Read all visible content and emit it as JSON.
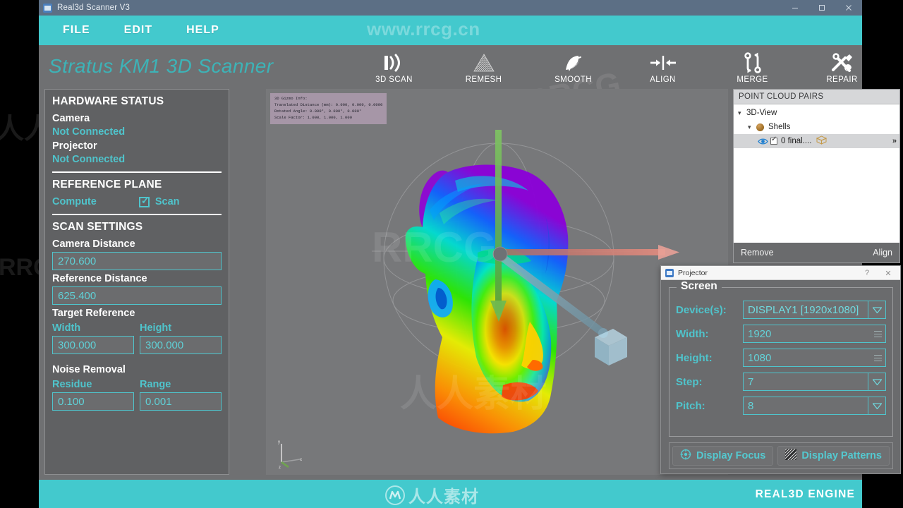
{
  "window": {
    "title": "Real3d Scanner V3",
    "controls": {
      "minimize": "minimize-icon",
      "maximize": "maximize-icon",
      "close": "close-icon"
    }
  },
  "menubar": {
    "items": [
      {
        "label": "FILE"
      },
      {
        "label": "EDIT"
      },
      {
        "label": "HELP"
      }
    ],
    "watermark": "www.rrcg.cn"
  },
  "toolbar": {
    "brand": "Stratus KM1 3D Scanner",
    "tools": [
      {
        "label": "3D SCAN",
        "icon": "scan-wave-icon"
      },
      {
        "label": "REMESH",
        "icon": "triangle-mesh-icon"
      },
      {
        "label": "SMOOTH",
        "icon": "smooth-swirl-icon"
      },
      {
        "label": "ALIGN",
        "icon": "align-arrows-icon"
      },
      {
        "label": "MERGE",
        "icon": "merge-loop-icon"
      },
      {
        "label": "REPAIR",
        "icon": "wrench-screwdriver-icon"
      }
    ]
  },
  "sidebar": {
    "hardware_status": {
      "title": "HARDWARE STATUS",
      "camera_label": "Camera",
      "camera_status": "Not Connected",
      "projector_label": "Projector",
      "projector_status": "Not Connected"
    },
    "reference_plane": {
      "title": "REFERENCE PLANE",
      "compute_label": "Compute",
      "scan_label": "Scan",
      "scan_checked": true
    },
    "scan_settings": {
      "title": "SCAN SETTINGS",
      "camera_distance_label": "Camera Distance",
      "camera_distance_value": "270.600",
      "reference_distance_label": "Reference Distance",
      "reference_distance_value": "625.400",
      "target_reference_label": "Target Reference",
      "width_label": "Width",
      "width_value": "300.000",
      "height_label": "Height",
      "height_value": "300.000",
      "noise_removal_label": "Noise Removal",
      "residue_label": "Residue",
      "residue_value": "0.100",
      "range_label": "Range",
      "range_value": "0.001"
    }
  },
  "viewport": {
    "gizmo_info": "3D Gizmo Info:\nTranslated Distance (mm): 0.000, 0.000, 0.0000\nRotated Angle: 0.000°, 0.000°, 0.000°\nScale Factor: 1.000, 1.000, 1.000",
    "axis_labels": {
      "x": "x",
      "y": "y",
      "z": "z"
    }
  },
  "point_cloud_pairs": {
    "title": "POINT CLOUD PAIRS",
    "tree": [
      {
        "label": "3D-View",
        "level": 1,
        "expanded": true
      },
      {
        "label": "Shells",
        "level": 2,
        "expanded": true
      },
      {
        "label": "0 final....",
        "level": 3,
        "checked": true,
        "selected": true
      }
    ],
    "remove_label": "Remove",
    "align_label": "Align"
  },
  "projector_dialog": {
    "title": "Projector",
    "help_label": "?",
    "close_label": "✕",
    "group_title": "Screen",
    "fields": [
      {
        "label": "Device(s):",
        "value": "DISPLAY1 [1920x1080]",
        "control": "dropdown"
      },
      {
        "label": "Width:",
        "value": "1920",
        "control": "spinner"
      },
      {
        "label": "Height:",
        "value": "1080",
        "control": "spinner"
      },
      {
        "label": "Step:",
        "value": "7",
        "control": "dropdown"
      },
      {
        "label": "Pitch:",
        "value": "8",
        "control": "dropdown"
      }
    ],
    "display_focus_label": "Display Focus",
    "display_patterns_label": "Display Patterns"
  },
  "statusbar": {
    "logo_text": "人人素材",
    "engine_label": "REAL3D  ENGINE"
  },
  "watermarks": {
    "rrcg": "RRCG",
    "cn": "人人素材"
  },
  "colors": {
    "teal": "#43c9cd",
    "accent_text": "#4fc4cc",
    "toolbar_gray": "#6f7072",
    "panel_gray": "#606163",
    "titlebar": "#5c6f85"
  }
}
